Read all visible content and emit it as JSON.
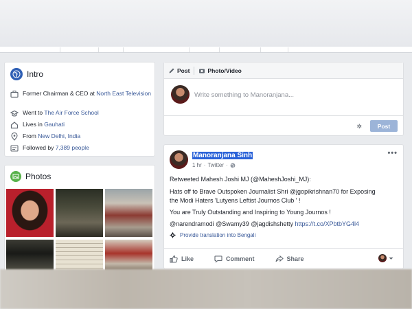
{
  "intro": {
    "title": "Intro",
    "items": [
      {
        "icon": "briefcase-icon",
        "prefix": "Former Chairman & CEO at ",
        "link": "North East Television"
      },
      {
        "icon": "graduation-cap-icon",
        "prefix": "Went to ",
        "link": "The Air Force School"
      },
      {
        "icon": "home-icon",
        "prefix": "Lives in ",
        "link": "Gauhati"
      },
      {
        "icon": "location-pin-icon",
        "prefix": "From ",
        "link": "New Delhi, India"
      },
      {
        "icon": "followers-icon",
        "prefix": "Followed by ",
        "link": "7,389 people"
      }
    ]
  },
  "photos": {
    "title": "Photos"
  },
  "composer": {
    "tab_post": "Post",
    "tab_photo": "Photo/Video",
    "placeholder": "Write something to Manoranjana...",
    "post_button": "Post"
  },
  "post": {
    "author": "Manoranjana Sinh",
    "time": "1 hr",
    "via": "Twitter",
    "more": "•••",
    "lines": [
      "Retweeted Mahesh Joshi MJ (@MaheshJoshi_MJ):",
      "Hats off to Brave Outspoken Journalist Shri @jgopikrishnan70 for Exposing",
      "the Modi Haters 'Lutyens Leftist Journos Club ' !",
      "You are Truly Outstanding and Inspiring to Young Journos !",
      "@narendramodi @Swamy39 @jagdishshetty"
    ],
    "link": "https://t.co/XPbtbYG4l4",
    "translate": "Provide translation into Bengali",
    "actions": {
      "like": "Like",
      "comment": "Comment",
      "share": "Share"
    }
  },
  "colors": {
    "link": "#385898",
    "accent": "#4267b2",
    "post_button": "#9cb4d8"
  }
}
